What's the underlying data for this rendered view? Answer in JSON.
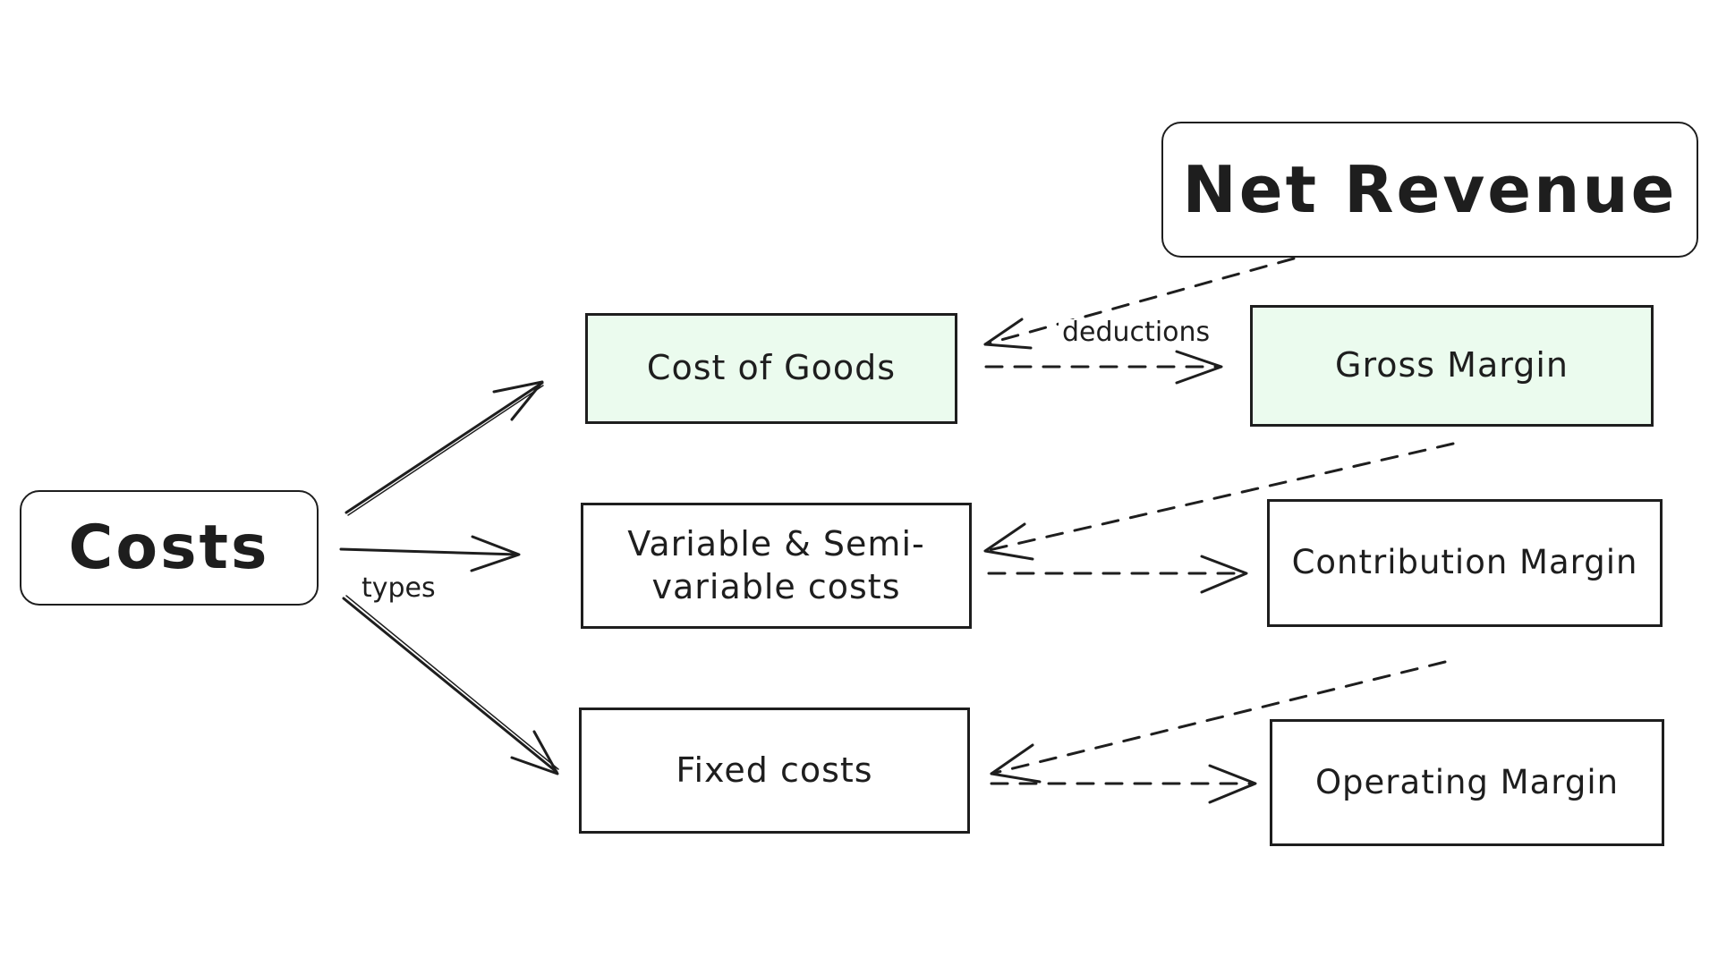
{
  "diagram": {
    "colors": {
      "stroke": "#1e1e1e",
      "highlight_fill": "#ebfbee",
      "default_fill": "#ffffff"
    },
    "nodes": {
      "net_revenue": {
        "label": "Net Revenue",
        "highlighted": false
      },
      "costs": {
        "label": "Costs",
        "highlighted": false
      },
      "cost_of_goods": {
        "label": "Cost of Goods",
        "highlighted": true
      },
      "variable_costs": {
        "label_line1": "Variable & Semi-",
        "label_line2": "variable costs",
        "highlighted": false
      },
      "fixed_costs": {
        "label": "Fixed costs",
        "highlighted": false
      },
      "gross_margin": {
        "label": "Gross Margin",
        "highlighted": true
      },
      "contribution_margin": {
        "label": "Contribution Margin",
        "highlighted": false
      },
      "operating_margin": {
        "label": "Operating Margin",
        "highlighted": false
      }
    },
    "edge_labels": {
      "deductions": "deductions",
      "types": "types"
    },
    "edges": [
      {
        "from": "costs",
        "to": "cost_of_goods",
        "style": "solid",
        "label": ""
      },
      {
        "from": "costs",
        "to": "variable_costs",
        "style": "solid",
        "label": ""
      },
      {
        "from": "costs",
        "to": "fixed_costs",
        "style": "solid",
        "label": "types"
      },
      {
        "from": "net_revenue",
        "to": "cost_of_goods",
        "style": "dashed",
        "label": "deductions"
      },
      {
        "from": "cost_of_goods",
        "to": "gross_margin",
        "style": "dashed",
        "label": ""
      },
      {
        "from": "gross_margin",
        "to": "variable_costs",
        "style": "dashed",
        "label": ""
      },
      {
        "from": "variable_costs",
        "to": "contribution_margin",
        "style": "dashed",
        "label": ""
      },
      {
        "from": "contribution_margin",
        "to": "fixed_costs",
        "style": "dashed",
        "label": ""
      },
      {
        "from": "fixed_costs",
        "to": "operating_margin",
        "style": "dashed",
        "label": ""
      }
    ]
  }
}
